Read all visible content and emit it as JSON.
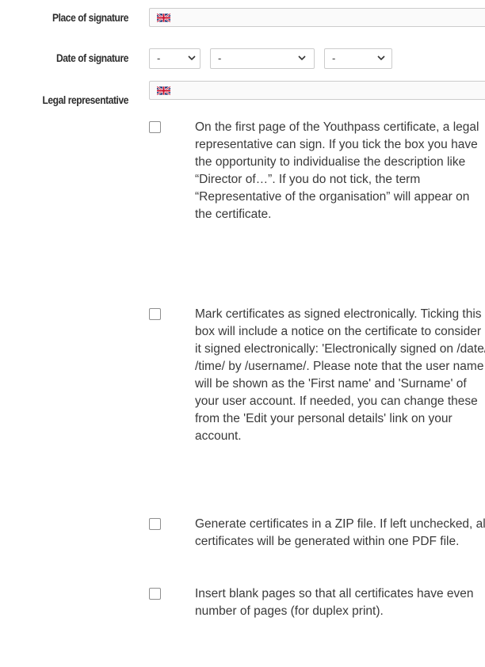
{
  "fields": {
    "place_label": "Place of signature",
    "date_label": "Date of signature",
    "legal_label": "Legal representative",
    "place_flag_icon": "uk-flag-icon",
    "legal_flag_icon": "uk-flag-icon"
  },
  "date": {
    "day": "-",
    "month": "-",
    "year": "-"
  },
  "options": [
    {
      "checked": false,
      "text": "On the first page of the Youthpass certificate, a legal representative can sign. If you tick the box you have the opportunity to individualise the description like “Director of…”. If you do not tick, the term “Representative of the organisation” will appear on the certificate."
    },
    {
      "checked": false,
      "text": "Mark certificates as signed electronically. Ticking this box will include a notice on the certificate to consider it signed electronically: 'Electronically signed on /date/ /time/ by /username/. Please note that the user name will be shown as the 'First name' and 'Surname' of your user account. If needed, you can change these from the 'Edit your personal details' link on your account."
    },
    {
      "checked": false,
      "text": "Generate certificates in a ZIP file. If left unchecked, all certificates will be generated within one PDF file."
    },
    {
      "checked": false,
      "text": "Insert blank pages so that all certificates have even number of pages (for duplex print)."
    }
  ],
  "colors": {
    "label": "#2c2c2c",
    "text": "#3a3a3a",
    "border": "#cccccc",
    "flag_blue": "#012169",
    "flag_red": "#C8102E"
  }
}
